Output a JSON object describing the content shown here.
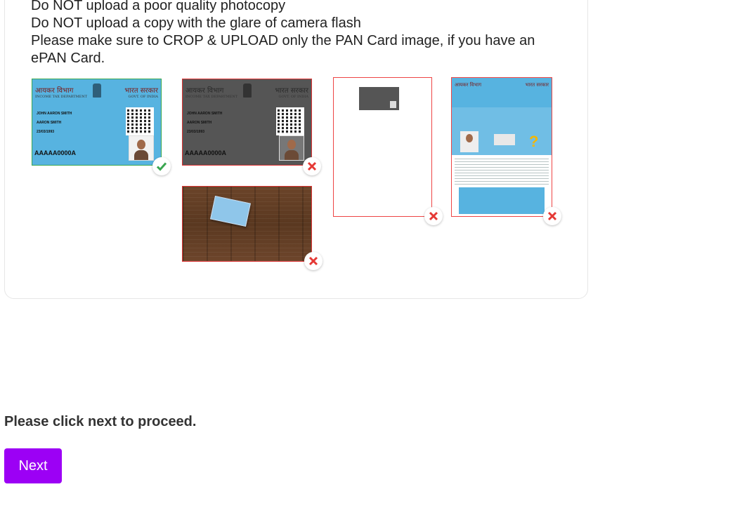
{
  "instructions": [
    "Do NOT upload a poor quality photocopy",
    "Do NOT upload a copy with the glare of camera flash",
    "Please make sure to CROP & UPLOAD only the PAN Card image, if you have an ePAN Card."
  ],
  "examples": {
    "good_card": {
      "hindi_left": "आयकर विभाग",
      "eng_left": "INCOME TAX DEPARTMENT",
      "hindi_right": "भारत सरकार",
      "eng_right": "GOVT. OF INDIA",
      "name": "JOHN AARON SMITH",
      "father": "AARON SMITH",
      "dob": "23/03/1993",
      "pan": "AAAAA0000A",
      "status_icon": "check-icon"
    },
    "photocopy_card": {
      "hindi_left": "आयकर विभाग",
      "eng_left": "INCOME TAX DEPARTMENT",
      "hindi_right": "भारत सरकार",
      "eng_right": "GOVT. OF INDIA",
      "name": "JOHN AARON SMITH",
      "father": "AARON SMITH",
      "dob": "23/03/1993",
      "pan": "AAAAA0000A",
      "status_icon": "cross-icon"
    },
    "epan": {
      "hindi_left": "आयकर विभाग",
      "hindi_right": "भारत सरकार",
      "status_icon": "cross-icon"
    }
  },
  "colors": {
    "accent": "#9c00f5",
    "good": "#3aa650",
    "bad": "#e53935",
    "card_blue": "#57b3e0"
  },
  "footer": {
    "proceed_text": "Please click next to proceed.",
    "next_label": "Next"
  }
}
